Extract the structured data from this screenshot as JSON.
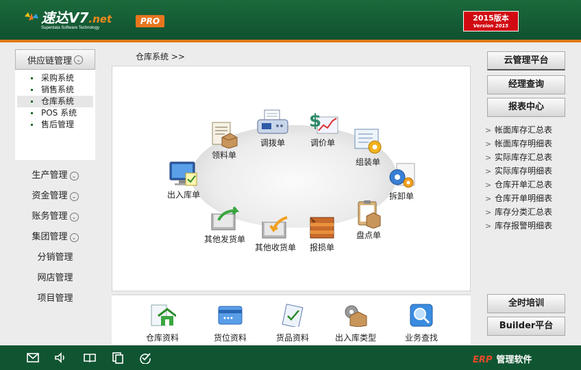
{
  "header": {
    "logo_text": "速达V7",
    "logo_net": ".net",
    "logo_sub": "Superdata Software Technology",
    "pro_badge": "PRO",
    "version_line1": "2015版本",
    "version_line2": "Version 2015"
  },
  "left_nav": {
    "supply_chain": "供应链管理",
    "sub_items": [
      "采购系统",
      "销售系统",
      "仓库系统",
      "POS 系统",
      "售后管理"
    ],
    "items": [
      "生产管理",
      "资金管理",
      "账务管理",
      "集团管理",
      "分销管理",
      "网店管理",
      "项目管理"
    ]
  },
  "breadcrumb": "仓库系统  >>",
  "modules": {
    "lingliao": "领料单",
    "diaobo": "调拨单",
    "tiaojia": "调价单",
    "zuzhuang": "组装单",
    "chuxie": "拆卸单",
    "churuku": "出入库单",
    "qitafahuo": "其他发货单",
    "qitashouhuo": "其他收货单",
    "baosun": "报损单",
    "pandian": "盘点单"
  },
  "tools": [
    "仓库资料",
    "货位资料",
    "货品资料",
    "出入库类型",
    "业务查找"
  ],
  "right": {
    "cloud": "云管理平台",
    "manager": "经理查询",
    "report_center": "报表中心",
    "reports": [
      "帐面库存汇总表",
      "帐面库存明细表",
      "实际库存汇总表",
      "实际库存明细表",
      "仓库开单汇总表",
      "仓库开单明细表",
      "库存分类汇总表",
      "库存报警明细表"
    ],
    "training": "全时培训",
    "builder": "Builder平台"
  },
  "footer": {
    "erp": "ERP",
    "label": "管理软件"
  },
  "colors": {
    "header_green": "#1c6a3c",
    "accent_orange": "#e07a18",
    "version_red": "#d10a12",
    "footer_green": "#105532"
  }
}
